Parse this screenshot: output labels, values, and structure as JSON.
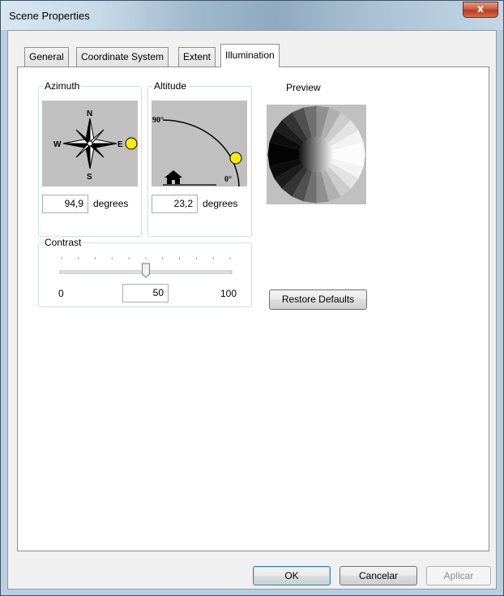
{
  "window": {
    "title": "Scene Properties",
    "close_glyph": "x"
  },
  "tabs": [
    {
      "label": "General",
      "active": false
    },
    {
      "label": "Coordinate System",
      "active": false
    },
    {
      "label": "Extent",
      "active": false
    },
    {
      "label": "Illumination",
      "active": true
    }
  ],
  "azimuth": {
    "label": "Azimuth",
    "compass": {
      "n": "N",
      "s": "S",
      "w": "W",
      "e": "E"
    },
    "value": "94,9",
    "unit": "degrees",
    "icon": "compass-rose-icon"
  },
  "altitude": {
    "label": "Altitude",
    "top_mark": "90°",
    "bottom_mark": "0°",
    "value": "23,2",
    "unit": "degrees",
    "icon": "house-icon"
  },
  "preview": {
    "label": "Preview"
  },
  "contrast": {
    "label": "Contrast",
    "min_label": "0",
    "max_label": "100",
    "value": "50",
    "level_fraction": 0.5
  },
  "buttons": {
    "restore": "Restore Defaults",
    "ok": "OK",
    "cancel": "Cancelar",
    "apply": "Aplicar"
  },
  "colors": {
    "sun": "#ffee00",
    "picture_bg": "#c0c0c0"
  }
}
